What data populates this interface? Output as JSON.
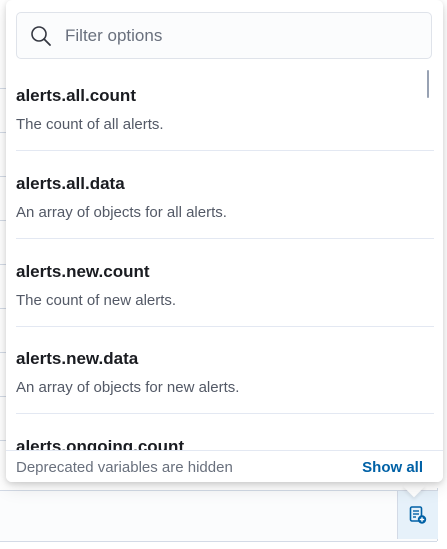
{
  "search": {
    "placeholder": "Filter options"
  },
  "options": [
    {
      "name": "alerts.all.count",
      "description": "The count of all alerts."
    },
    {
      "name": "alerts.all.data",
      "description": "An array of objects for all alerts."
    },
    {
      "name": "alerts.new.count",
      "description": "The count of new alerts."
    },
    {
      "name": "alerts.new.data",
      "description": "An array of objects for new alerts."
    },
    {
      "name": "alerts.ongoing.count",
      "description": ""
    }
  ],
  "footer": {
    "deprecated_text": "Deprecated variables are hidden",
    "show_all_label": "Show all"
  },
  "colors": {
    "link": "#0061a6",
    "accent_bg": "#e6f1fa",
    "icon": "#0061a6"
  },
  "icons": {
    "search": "search-icon",
    "variable_button": "variables-icon"
  }
}
